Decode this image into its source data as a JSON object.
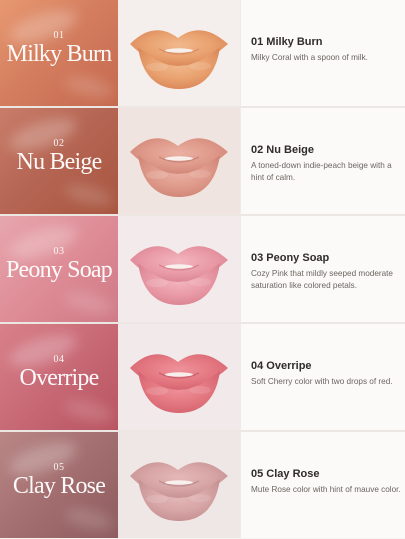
{
  "colors": {
    "background": "#f7f5f2",
    "text_dark": "#2f2c2a",
    "text_muted": "#6b6561"
  },
  "shades": [
    {
      "number": "01",
      "swatch_name": "Milky Burn",
      "title": "01 Milky Burn",
      "description": "Milky Coral with a spoon of milk.",
      "swatch_color": "#d47e5f",
      "lip_color": "#e8a06f"
    },
    {
      "number": "02",
      "swatch_name": "Nu Beige",
      "title": "02 Nu Beige",
      "description": "A toned-down indie-peach beige with a hint of calm.",
      "swatch_color": "#b66654",
      "lip_color": "#e19a8c"
    },
    {
      "number": "03",
      "swatch_name": "Peony Soap",
      "title": "03 Peony Soap",
      "description": "Cozy Pink that mildly seeped moderate saturation like colored petals.",
      "swatch_color": "#de8c96",
      "lip_color": "#ea9aa6"
    },
    {
      "number": "04",
      "swatch_name": "Overripe",
      "title": "04 Overripe",
      "description": "Soft Cherry color with two drops of red.",
      "swatch_color": "#c86976",
      "lip_color": "#e47780"
    },
    {
      "number": "05",
      "swatch_name": "Clay Rose",
      "title": "05 Clay Rose",
      "description": "Mute Rose color with hint of mauve color.",
      "swatch_color": "#a46f70",
      "lip_color": "#d7a5a5"
    }
  ]
}
